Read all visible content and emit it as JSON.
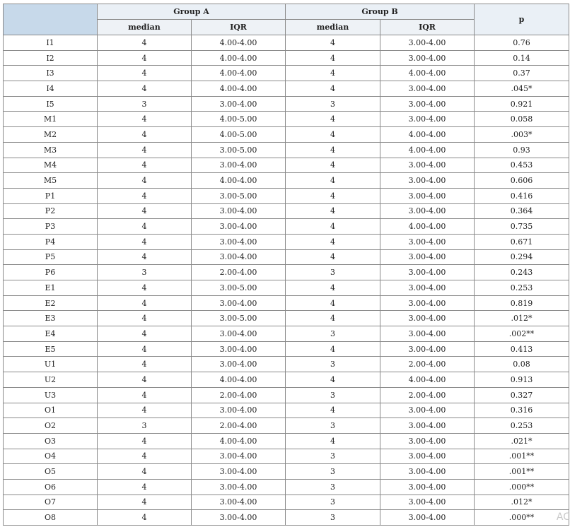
{
  "header": {
    "group_a": "Group A",
    "group_b": "Group B",
    "p": "p",
    "median": "median",
    "iqr": "IQR"
  },
  "rows": [
    {
      "item": "I1",
      "a_median": "4",
      "a_iqr": "4.00-4.00",
      "b_median": "4",
      "b_iqr": "3.00-4.00",
      "p": "0.76"
    },
    {
      "item": "I2",
      "a_median": "4",
      "a_iqr": "4.00-4.00",
      "b_median": "4",
      "b_iqr": "3.00-4.00",
      "p": "0.14"
    },
    {
      "item": "I3",
      "a_median": "4",
      "a_iqr": "4.00-4.00",
      "b_median": "4",
      "b_iqr": "4.00-4.00",
      "p": "0.37"
    },
    {
      "item": "I4",
      "a_median": "4",
      "a_iqr": "4.00-4.00",
      "b_median": "4",
      "b_iqr": "3.00-4.00",
      "p": ".045*"
    },
    {
      "item": "I5",
      "a_median": "3",
      "a_iqr": "3.00-4.00",
      "b_median": "3",
      "b_iqr": "3.00-4.00",
      "p": "0.921"
    },
    {
      "item": "M1",
      "a_median": "4",
      "a_iqr": "4.00-5.00",
      "b_median": "4",
      "b_iqr": "3.00-4.00",
      "p": "0.058"
    },
    {
      "item": "M2",
      "a_median": "4",
      "a_iqr": "4.00-5.00",
      "b_median": "4",
      "b_iqr": "4.00-4.00",
      "p": ".003*"
    },
    {
      "item": "M3",
      "a_median": "4",
      "a_iqr": "3.00-5.00",
      "b_median": "4",
      "b_iqr": "4.00-4.00",
      "p": "0.93"
    },
    {
      "item": "M4",
      "a_median": "4",
      "a_iqr": "3.00-4.00",
      "b_median": "4",
      "b_iqr": "3.00-4.00",
      "p": "0.453"
    },
    {
      "item": "M5",
      "a_median": "4",
      "a_iqr": "4.00-4.00",
      "b_median": "4",
      "b_iqr": "3.00-4.00",
      "p": "0.606"
    },
    {
      "item": "P1",
      "a_median": "4",
      "a_iqr": "3.00-5.00",
      "b_median": "4",
      "b_iqr": "3.00-4.00",
      "p": "0.416"
    },
    {
      "item": "P2",
      "a_median": "4",
      "a_iqr": "3.00-4.00",
      "b_median": "4",
      "b_iqr": "3.00-4.00",
      "p": "0.364"
    },
    {
      "item": "P3",
      "a_median": "4",
      "a_iqr": "3.00-4.00",
      "b_median": "4",
      "b_iqr": "4.00-4.00",
      "p": "0.735"
    },
    {
      "item": "P4",
      "a_median": "4",
      "a_iqr": "3.00-4.00",
      "b_median": "4",
      "b_iqr": "3.00-4.00",
      "p": "0.671"
    },
    {
      "item": "P5",
      "a_median": "4",
      "a_iqr": "3.00-4.00",
      "b_median": "4",
      "b_iqr": "3.00-4.00",
      "p": "0.294"
    },
    {
      "item": "P6",
      "a_median": "3",
      "a_iqr": "2.00-4.00",
      "b_median": "3",
      "b_iqr": "3.00-4.00",
      "p": "0.243"
    },
    {
      "item": "E1",
      "a_median": "4",
      "a_iqr": "3.00-5.00",
      "b_median": "4",
      "b_iqr": "3.00-4.00",
      "p": "0.253"
    },
    {
      "item": "E2",
      "a_median": "4",
      "a_iqr": "3.00-4.00",
      "b_median": "4",
      "b_iqr": "3.00-4.00",
      "p": "0.819"
    },
    {
      "item": "E3",
      "a_median": "4",
      "a_iqr": "3.00-5.00",
      "b_median": "4",
      "b_iqr": "3.00-4.00",
      "p": ".012*"
    },
    {
      "item": "E4",
      "a_median": "4",
      "a_iqr": "3.00-4.00",
      "b_median": "3",
      "b_iqr": "3.00-4.00",
      "p": ".002**"
    },
    {
      "item": "E5",
      "a_median": "4",
      "a_iqr": "3.00-4.00",
      "b_median": "4",
      "b_iqr": "3.00-4.00",
      "p": "0.413"
    },
    {
      "item": "U1",
      "a_median": "4",
      "a_iqr": "3.00-4.00",
      "b_median": "3",
      "b_iqr": "2.00-4.00",
      "p": "0.08"
    },
    {
      "item": "U2",
      "a_median": "4",
      "a_iqr": "4.00-4.00",
      "b_median": "4",
      "b_iqr": "4.00-4.00",
      "p": "0.913"
    },
    {
      "item": "U3",
      "a_median": "4",
      "a_iqr": "2.00-4.00",
      "b_median": "3",
      "b_iqr": "2.00-4.00",
      "p": "0.327"
    },
    {
      "item": "O1",
      "a_median": "4",
      "a_iqr": "3.00-4.00",
      "b_median": "4",
      "b_iqr": "3.00-4.00",
      "p": "0.316"
    },
    {
      "item": "O2",
      "a_median": "3",
      "a_iqr": "2.00-4.00",
      "b_median": "3",
      "b_iqr": "3.00-4.00",
      "p": "0.253"
    },
    {
      "item": "O3",
      "a_median": "4",
      "a_iqr": "4.00-4.00",
      "b_median": "4",
      "b_iqr": "3.00-4.00",
      "p": ".021*"
    },
    {
      "item": "O4",
      "a_median": "4",
      "a_iqr": "3.00-4.00",
      "b_median": "3",
      "b_iqr": "3.00-4.00",
      "p": ".001**"
    },
    {
      "item": "O5",
      "a_median": "4",
      "a_iqr": "3.00-4.00",
      "b_median": "3",
      "b_iqr": "3.00-4.00",
      "p": ".001**"
    },
    {
      "item": "O6",
      "a_median": "4",
      "a_iqr": "3.00-4.00",
      "b_median": "3",
      "b_iqr": "3.00-4.00",
      "p": ".000**"
    },
    {
      "item": "O7",
      "a_median": "4",
      "a_iqr": "3.00-4.00",
      "b_median": "3",
      "b_iqr": "3.00-4.00",
      "p": ".012*"
    },
    {
      "item": "O8",
      "a_median": "4",
      "a_iqr": "3.00-4.00",
      "b_median": "3",
      "b_iqr": "3.00-4.00",
      "p": ".000**"
    }
  ],
  "watermark": "AC"
}
